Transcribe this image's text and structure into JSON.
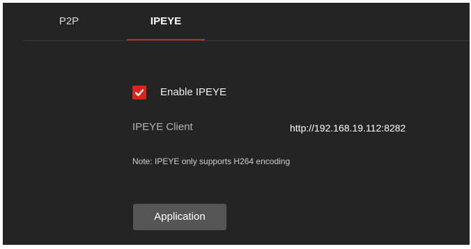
{
  "tabs": [
    {
      "label": "P2P",
      "active": false
    },
    {
      "label": "IPEYE",
      "active": true
    }
  ],
  "settings": {
    "enable_label": "Enable IPEYE",
    "enable_checked": true,
    "client_label": "IPEYE Client",
    "client_value": "http://192.168.19.112:8282",
    "note": "Note: IPEYE only supports H264 encoding",
    "button_label": "Application"
  },
  "colors": {
    "background": "#242424",
    "accent": "#d9261c",
    "button": "#555555"
  },
  "icons": {
    "checkbox": "checkmark-icon"
  }
}
